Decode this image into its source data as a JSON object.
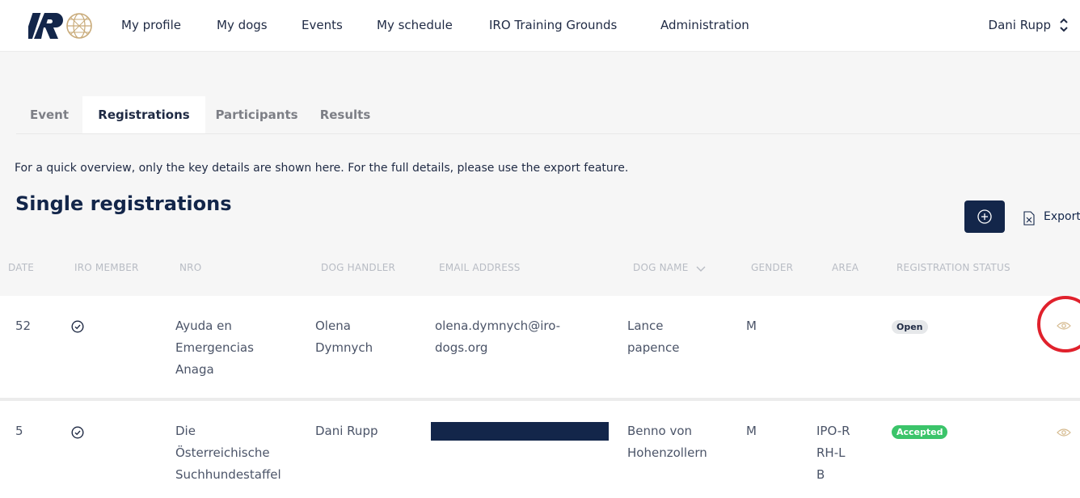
{
  "nav": {
    "items": [
      "My profile",
      "My dogs",
      "Events",
      "My schedule",
      "IRO Training Grounds",
      "Administration"
    ],
    "user": "Dani Rupp"
  },
  "tabs": [
    "Event",
    "Registrations",
    "Participants",
    "Results"
  ],
  "active_tab": "Registrations",
  "info_text": "For a quick overview, only the key details are shown here. For the full details, please use the export feature.",
  "section_title": "Single registrations",
  "actions": {
    "export_label": "Export"
  },
  "table": {
    "columns": [
      "DATE",
      "IRO MEMBER",
      "NRO",
      "DOG HANDLER",
      "EMAIL ADDRESS",
      "DOG NAME",
      "GENDER",
      "AREA",
      "REGISTRATION STATUS"
    ],
    "rows": [
      {
        "date": "52",
        "nro": [
          "Ayuda en",
          "Emergencias",
          "Anaga"
        ],
        "handler": [
          "Olena",
          "Dymnych"
        ],
        "email": [
          "olena.dymnych@iro-",
          "dogs.org"
        ],
        "dog_name": [
          "Lance",
          "papence"
        ],
        "gender": "M",
        "area": [],
        "status": "Open"
      },
      {
        "date": "5",
        "nro": [
          "Die",
          "Österreichische",
          "Suchhundestaffel"
        ],
        "handler": [
          "Dani Rupp"
        ],
        "email": [],
        "dog_name": [
          "Benno von",
          "Hohenzollern"
        ],
        "gender": "M",
        "area": [
          "IPO-R",
          "RH-L",
          "B"
        ],
        "status": "Accepted"
      }
    ]
  },
  "colors": {
    "navy": "#13264a",
    "accepted": "#3bc46a",
    "eye": "#d4b98c",
    "highlight": "#e0212c"
  }
}
